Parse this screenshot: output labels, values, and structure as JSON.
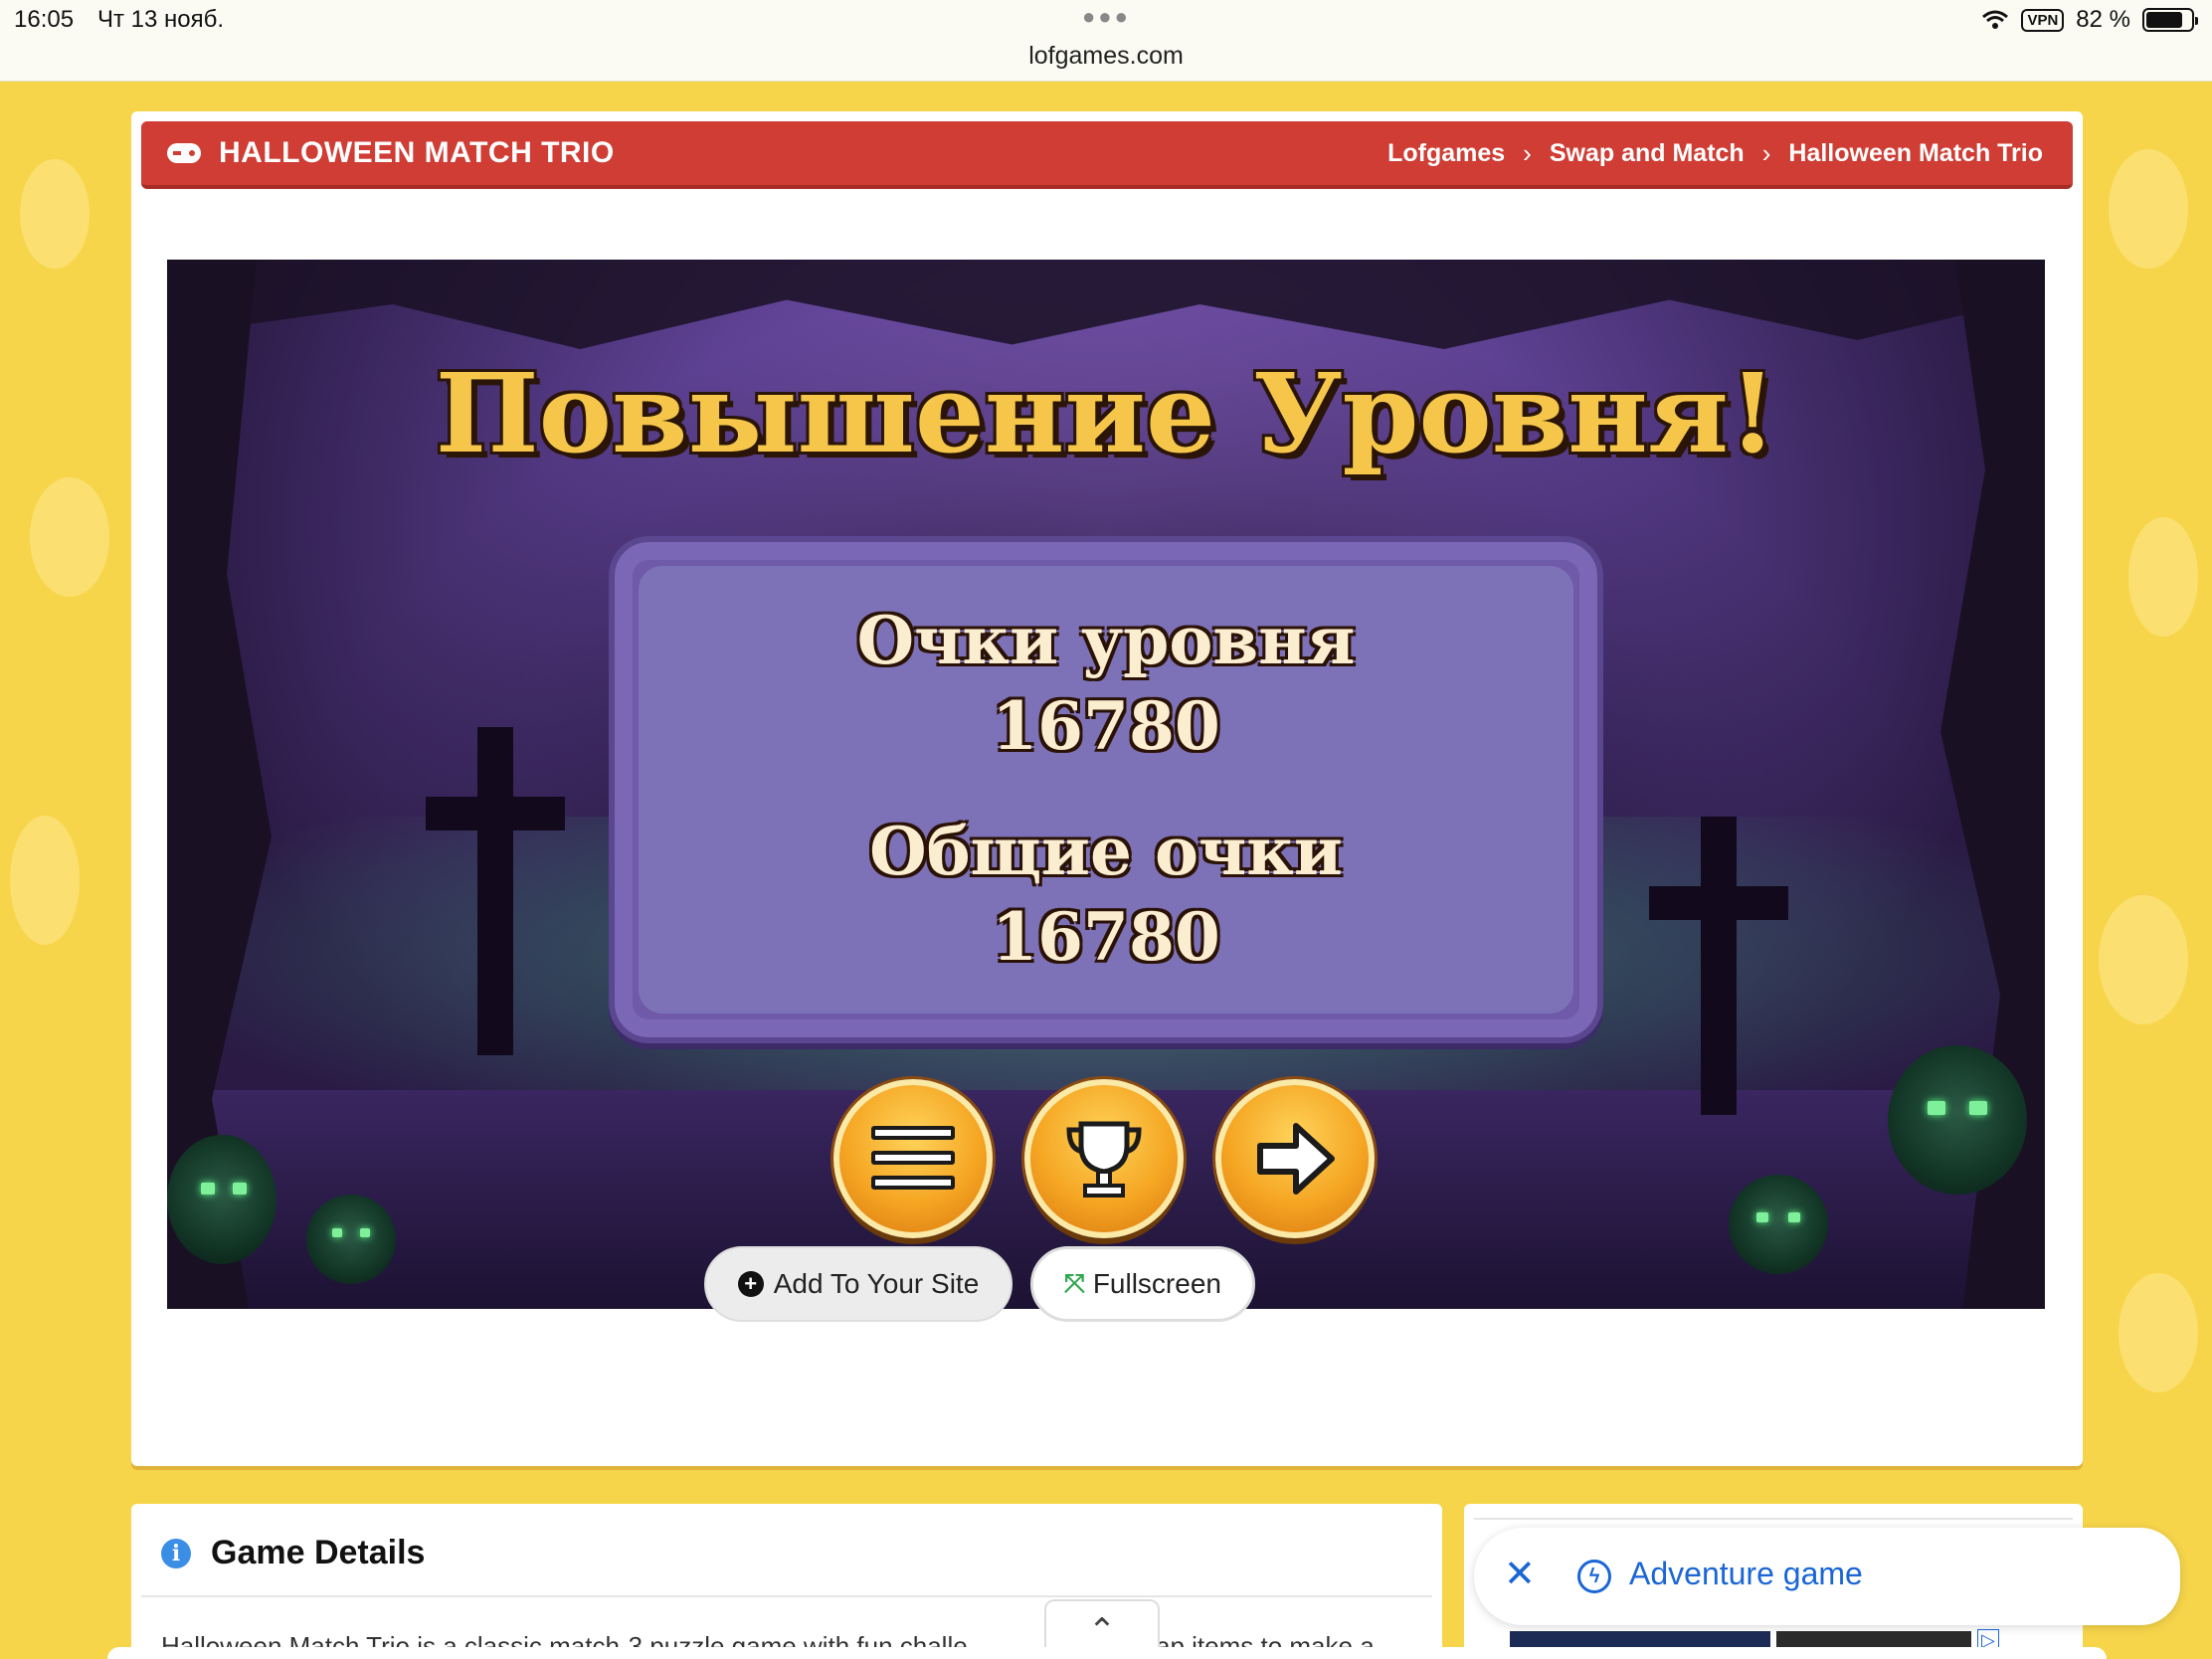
{
  "status_bar": {
    "time": "16:05",
    "date": "Чт 13 нояб.",
    "url": "lofgames.com",
    "vpn": "VPN",
    "battery": "82 %",
    "battery_level": 0.82
  },
  "header": {
    "title": "HALLOWEEN MATCH TRIO",
    "breadcrumb": [
      "Lofgames",
      "Swap and Match",
      "Halloween Match Trio"
    ]
  },
  "game": {
    "heading": "Повышение Уровня!",
    "level_score_label": "Очки уровня",
    "level_score": "16780",
    "total_score_label": "Общие очки",
    "total_score": "16780"
  },
  "actions": {
    "add_label": "Add To Your Site",
    "fullscreen_label": "Fullscreen"
  },
  "details": {
    "title": "Game Details",
    "text": "Halloween Match Trio is a classic match-3 puzzle game with fun challe",
    "text_tail": "ap items to make a"
  },
  "ad": {
    "label": "Adventure game"
  },
  "colors": {
    "background": "#f7d54a",
    "title_bar": "#cf3d35",
    "accent_blue": "#1a66d6",
    "score_panel": "#7d72b8"
  }
}
